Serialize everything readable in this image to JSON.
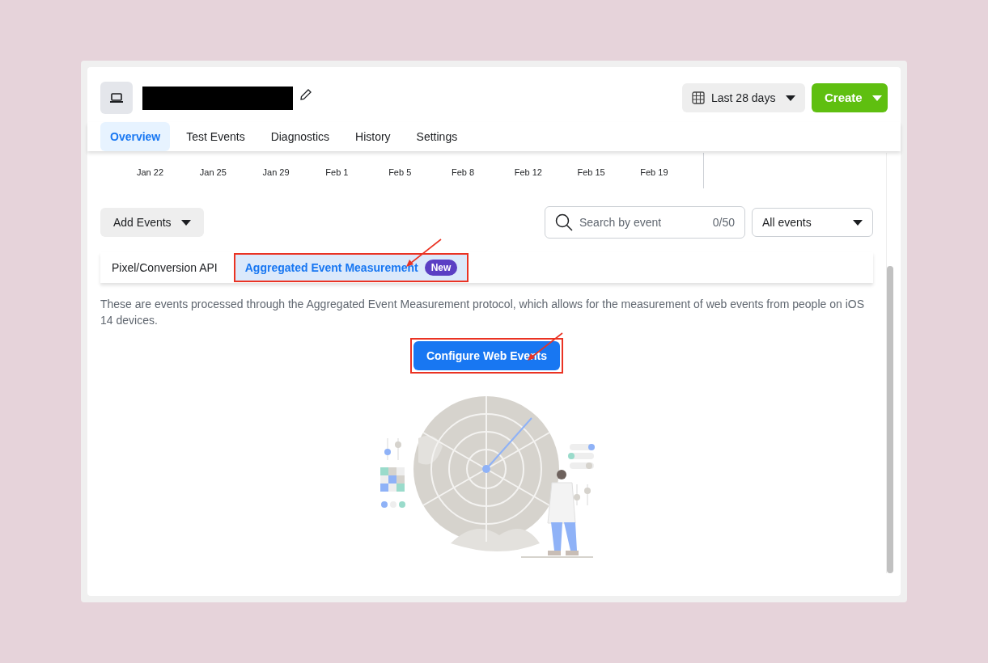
{
  "header": {
    "date_range": "Last 28 days",
    "create_button": "Create"
  },
  "tabs": [
    {
      "label": "Overview",
      "selected": true
    },
    {
      "label": "Test Events",
      "selected": false
    },
    {
      "label": "Diagnostics",
      "selected": false
    },
    {
      "label": "History",
      "selected": false
    },
    {
      "label": "Settings",
      "selected": false
    }
  ],
  "chart_axis_labels": [
    "Jan 22",
    "Jan 25",
    "Jan 29",
    "Feb 1",
    "Feb 5",
    "Feb 8",
    "Feb 12",
    "Feb 15",
    "Feb 19"
  ],
  "toolbar": {
    "add_events": "Add Events",
    "search": {
      "placeholder": "Search by event",
      "count": "0/50"
    },
    "filter": "All events"
  },
  "sub_tabs": [
    {
      "label": "Pixel/Conversion API",
      "selected": false,
      "highlighted": false
    },
    {
      "label": "Aggregated Event Measurement",
      "selected": true,
      "highlighted": true,
      "badge": "New"
    }
  ],
  "description": "These are events processed through the Aggregated Event Measurement protocol, which allows for the measurement of web events from people on iOS 14 devices.",
  "configure_button": {
    "label": "Configure Web Events",
    "highlighted": true
  }
}
